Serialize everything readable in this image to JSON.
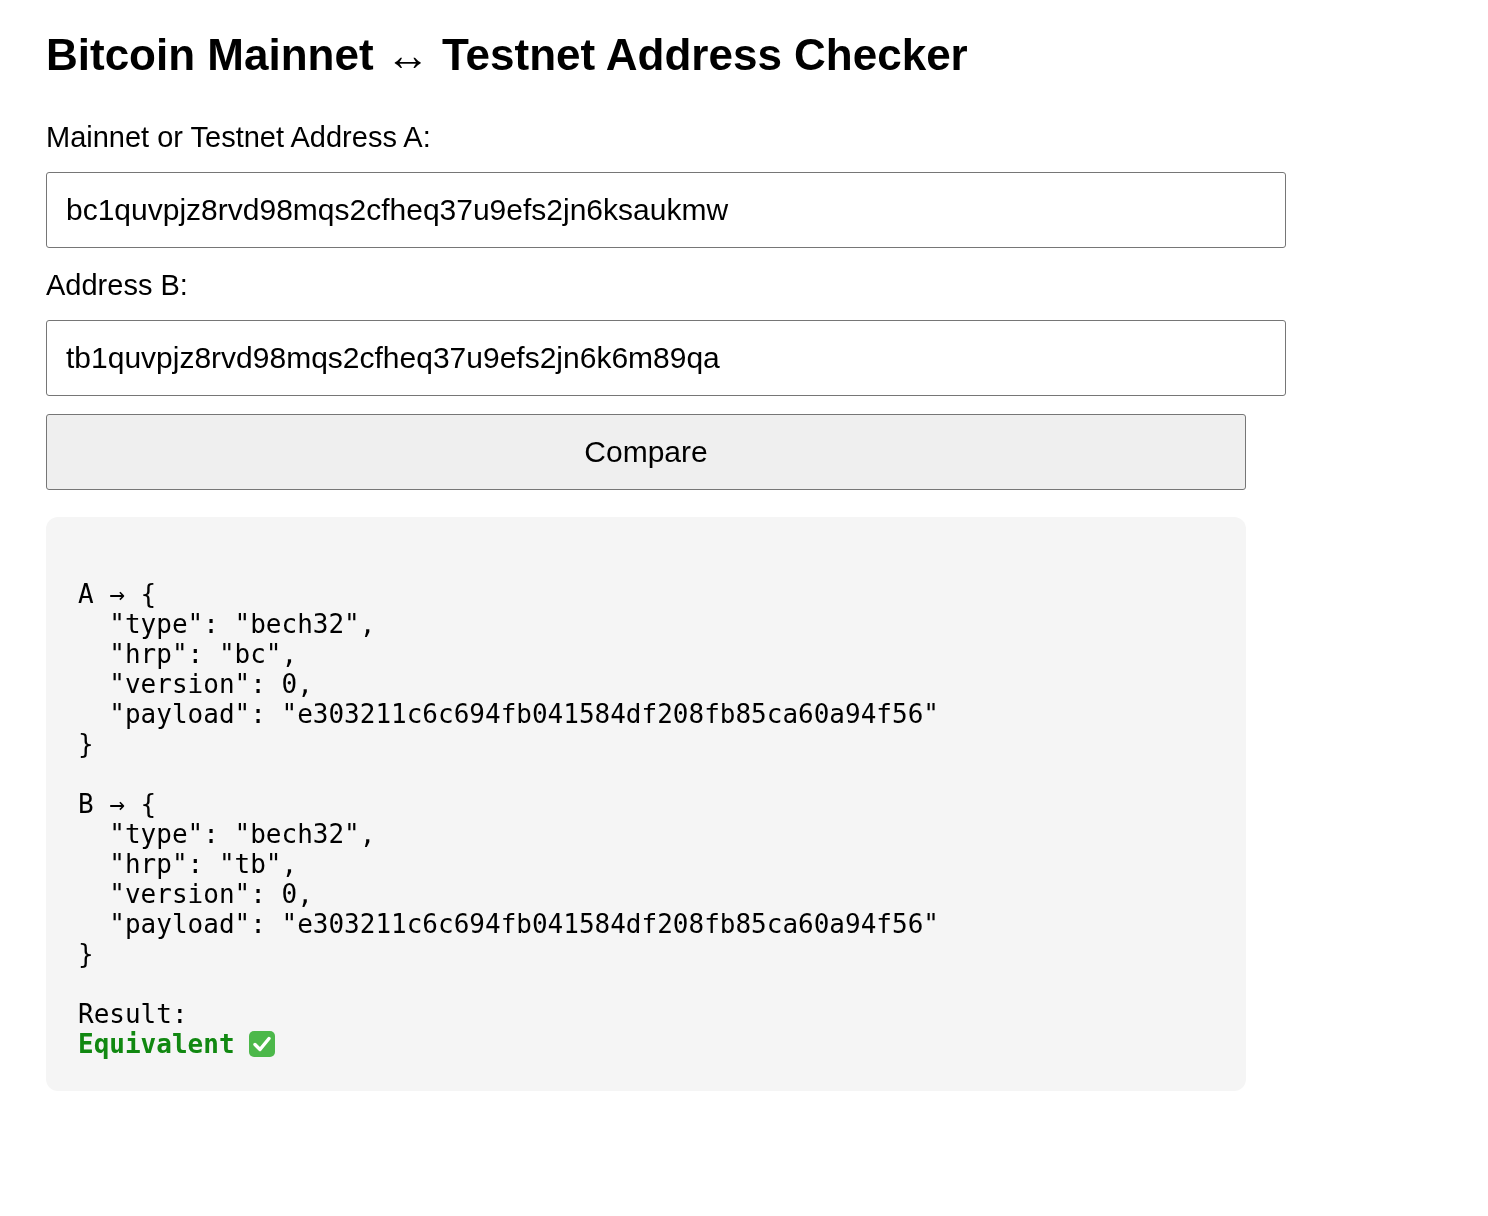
{
  "title": "Bitcoin Mainnet ↔ Testnet Address Checker",
  "fields": [
    {
      "label": "Mainnet or Testnet Address A:",
      "value": "bc1quvpjz8rvd98mqs2cfheq37u9efs2jn6ksaukmw"
    },
    {
      "label": "Address B:",
      "value": "tb1quvpjz8rvd98mqs2cfheq37u9efs2jn6k6m89qa"
    }
  ],
  "button": "Compare",
  "output": {
    "blocks": [
      {
        "lines": [
          "A → {",
          "  \"type\": \"bech32\",",
          "  \"hrp\": \"bc\",",
          "  \"version\": 0,",
          "  \"payload\": \"e303211c6c694fb041584df208fb85ca60a94f56\"",
          "}"
        ]
      },
      {
        "lines": [
          "B → {",
          "  \"type\": \"bech32\",",
          "  \"hrp\": \"tb\",",
          "  \"version\": 0,",
          "  \"payload\": \"e303211c6c694fb041584df208fb85ca60a94f56\"",
          "}"
        ]
      }
    ],
    "result_label": "Result:",
    "result": "Equivalent",
    "equivalent": true
  }
}
